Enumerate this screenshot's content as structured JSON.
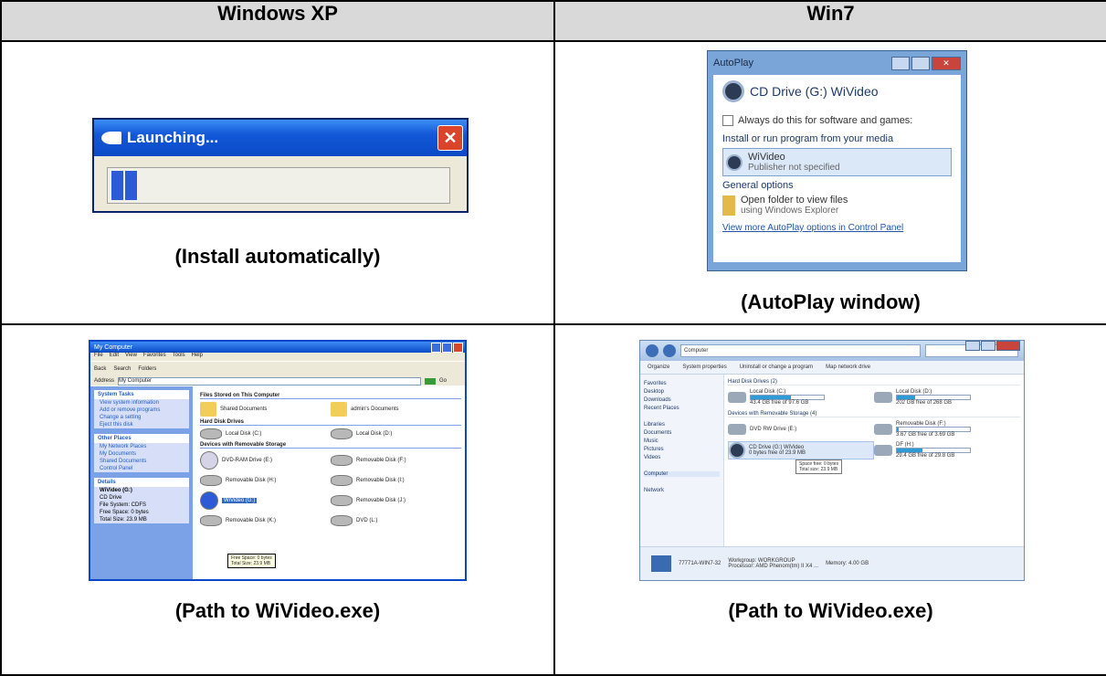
{
  "headers": {
    "col1": "Windows XP",
    "col2": "Win7"
  },
  "captions": {
    "xp_install": "(Install automatically)",
    "w7_autoplay": "(AutoPlay window)",
    "xp_path": "(Path to WiVideo.exe)",
    "w7_path": "(Path to WiVideo.exe)"
  },
  "xp_launch": {
    "title": "Launching...",
    "close": "✕",
    "progress_blocks": 2
  },
  "autoplay": {
    "title": "AutoPlay",
    "drive": "CD Drive (G:) WiVideo",
    "always_do": "Always do this for software and games:",
    "install_section": "Install or run program from your media",
    "program_name": "WiVideo",
    "program_sub": "Publisher not specified",
    "general_section": "General options",
    "open_folder": "Open folder to view files",
    "open_folder_sub": "using Windows Explorer",
    "link": "View more AutoPlay options in Control Panel"
  },
  "xp_mycomp": {
    "title": "My Computer",
    "menu": [
      "File",
      "Edit",
      "View",
      "Favorites",
      "Tools",
      "Help"
    ],
    "tools": [
      "Back",
      "Search",
      "Folders"
    ],
    "address_label": "Address",
    "address_value": "My Computer",
    "go": "Go",
    "panes": [
      {
        "title": "System Tasks",
        "links": [
          "View system information",
          "Add or remove programs",
          "Change a setting",
          "Eject this disk"
        ]
      },
      {
        "title": "Other Places",
        "links": [
          "My Network Places",
          "My Documents",
          "Shared Documents",
          "Control Panel"
        ]
      },
      {
        "title": "Details",
        "links": [
          "WiVideo (G:)",
          "CD Drive",
          "File System: CDFS",
          "Free Space: 0 bytes",
          "Total Size: 23.9 MB"
        ]
      }
    ],
    "groups": [
      {
        "title": "Files Stored on This Computer",
        "items": [
          "Shared Documents",
          "admin's Documents"
        ]
      },
      {
        "title": "Hard Disk Drives",
        "items": [
          "Local Disk (C:)",
          "Local Disk (D:)"
        ]
      },
      {
        "title": "Devices with Removable Storage",
        "items": [
          "DVD-RAM Drive (E:)",
          "Removable Disk (F:)",
          "Removable Disk (H:)",
          "Removable Disk (I:)",
          "WiVideo (G:)",
          "Removable Disk (J:)",
          "Removable Disk (K:)",
          "DVD (L:)"
        ]
      }
    ],
    "tooltip_lines": [
      "Free Space: 0 bytes",
      "Total Size: 23.9 MB"
    ]
  },
  "w7_comp": {
    "address": "Computer",
    "cmds": [
      "Organize",
      "System properties",
      "Uninstall or change a program",
      "Map network drive"
    ],
    "nav": [
      "Favorites",
      "Desktop",
      "Downloads",
      "Recent Places",
      "Libraries",
      "Documents",
      "Music",
      "Pictures",
      "Videos",
      "Computer",
      "Network"
    ],
    "hdd_group": "Hard Disk Drives (2)",
    "rem_group": "Devices with Removable Storage (4)",
    "drives": [
      {
        "name": "Local Disk (C:)",
        "sub": "43.4 GB free of 97.6 GB",
        "fill": 0.55
      },
      {
        "name": "Local Disk (D:)",
        "sub": "202 GB free of 268 GB",
        "fill": 0.25
      },
      {
        "name": "DVD RW Drive (E:)",
        "sub": "",
        "fill": 0
      },
      {
        "name": "Removable Disk (F:)",
        "sub": "3.67 GB free of 3.69 GB",
        "fill": 0.02
      },
      {
        "name": "CD Drive (G:) WiVideo",
        "sub": "0 bytes free of 23.9 MB",
        "fill": 1
      },
      {
        "name": "DF (H:)",
        "sub": "29.4 GB free of 29.8 GB",
        "fill": 0.35
      }
    ],
    "tooltip": "Space free: 0 bytes\nTotal size: 23.9 MB",
    "details_name": "77771A-WIN7-32",
    "details_workgroup": "Workgroup: WORKGROUP",
    "details_proc": "Processor: AMD Phenom(tm) II X4 ...",
    "details_mem": "Memory: 4.00 GB"
  }
}
